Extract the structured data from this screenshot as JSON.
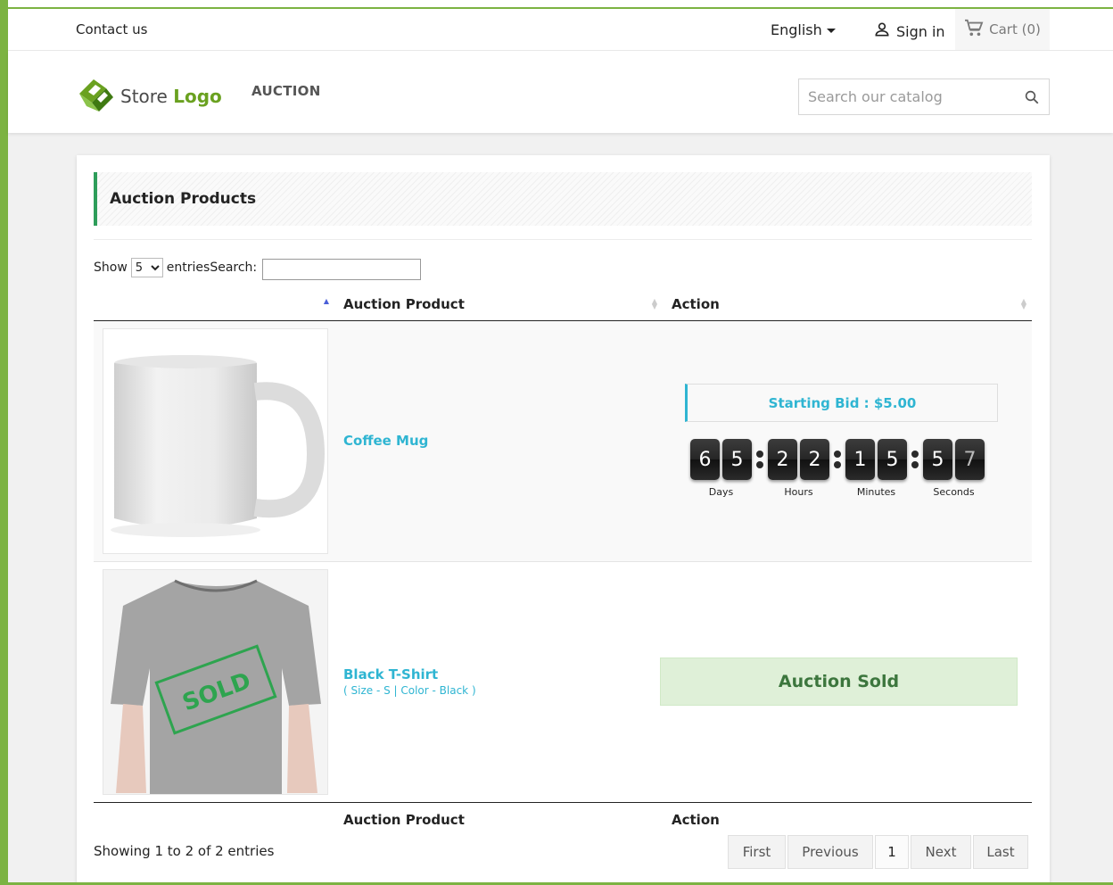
{
  "header": {
    "contact": "Contact us",
    "language": "English",
    "signin": "Sign in",
    "cart": "Cart (0)"
  },
  "nav": {
    "logo_prefix": "Store",
    "logo_suffix": "Logo",
    "auction_link": "AUCTION",
    "search_placeholder": "Search our catalog"
  },
  "page": {
    "title": "Auction Products",
    "show_label": "Show",
    "entries_value": "5",
    "entries_label": "entries",
    "search_label": "Search:"
  },
  "table": {
    "columns": [
      "",
      "Auction Product",
      "Action"
    ],
    "rows": [
      {
        "name": "Coffee Mug",
        "bid_text": "Starting Bid : $5.00",
        "countdown": {
          "days": [
            "6",
            "5"
          ],
          "hours": [
            "2",
            "2"
          ],
          "minutes": [
            "1",
            "5"
          ],
          "seconds": [
            "5",
            "7"
          ]
        },
        "labels": [
          "Days",
          "Hours",
          "Minutes",
          "Seconds"
        ]
      },
      {
        "name": "Black T-Shirt",
        "attributes": "( Size - S | Color - Black )",
        "stamp": "SOLD",
        "status": "Auction Sold"
      }
    ],
    "footer_columns": [
      "",
      "Auction Product",
      "Action"
    ]
  },
  "pagination": {
    "info": "Showing 1 to 2 of 2 entries",
    "first": "First",
    "previous": "Previous",
    "current": "1",
    "next": "Next",
    "last": "Last"
  },
  "colors": {
    "brand_green": "#7cb342",
    "link_blue": "#2fb5d2",
    "sold_green": "#3c763d",
    "title_accent": "#2e9d5a"
  },
  "icons": [
    "user-icon",
    "cart-icon",
    "search-icon",
    "store-logo-icon",
    "sort-icon"
  ]
}
